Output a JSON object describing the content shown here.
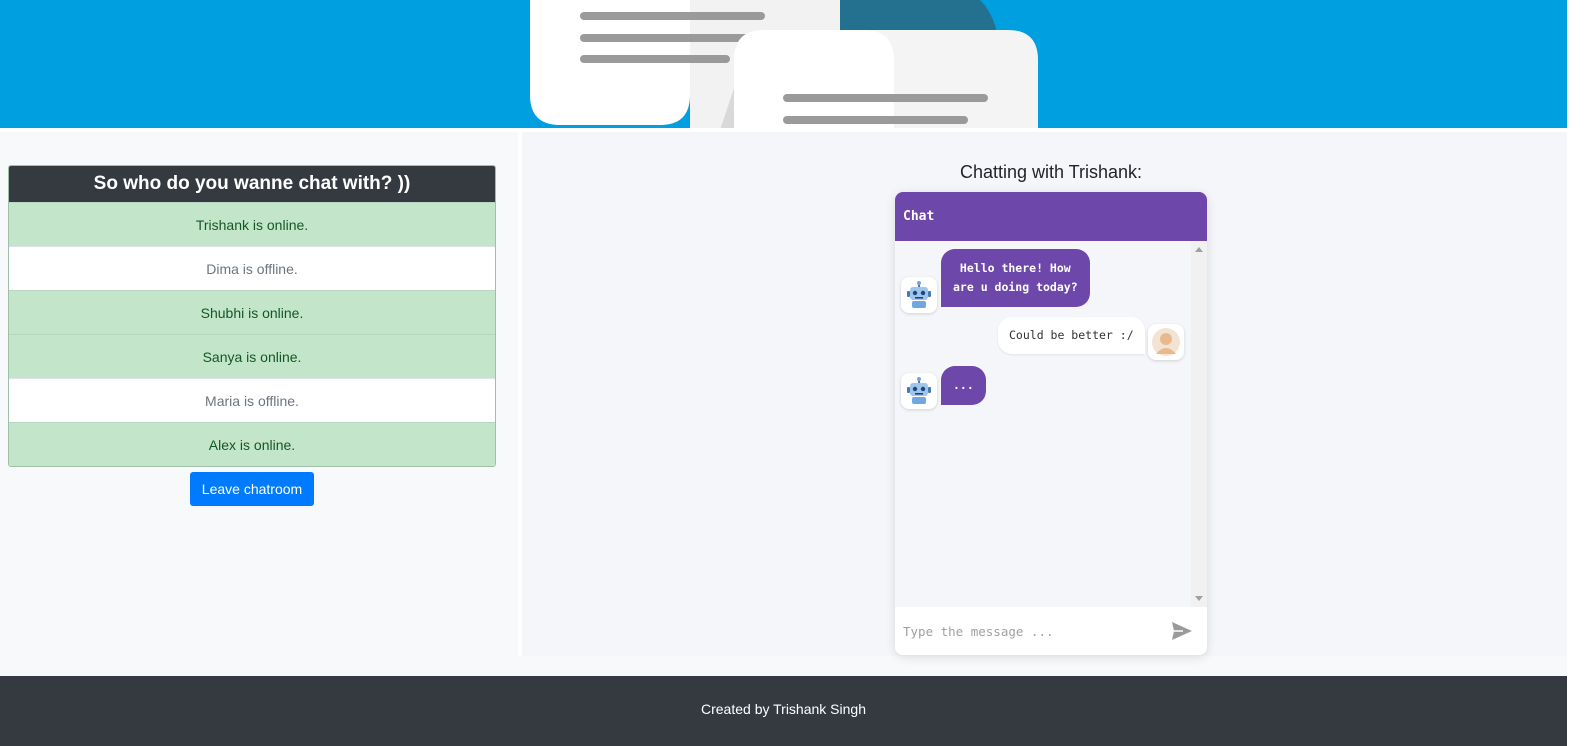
{
  "contacts": {
    "header": "So who do you wanne chat with? ))",
    "items": [
      {
        "text": "Trishank is online.",
        "status": "online"
      },
      {
        "text": "Dima is offline.",
        "status": "offline"
      },
      {
        "text": "Shubhi is online.",
        "status": "online"
      },
      {
        "text": "Sanya is online.",
        "status": "online"
      },
      {
        "text": "Maria is offline.",
        "status": "offline"
      },
      {
        "text": "Alex is online.",
        "status": "online"
      }
    ],
    "leave_label": "Leave chatroom"
  },
  "chat": {
    "title": "Chatting with Trishank:",
    "header": "Chat",
    "messages": [
      {
        "from": "bot",
        "line1": "Hello there! How",
        "line2": "are u doing today?"
      },
      {
        "from": "user",
        "text": "Could be better :/"
      },
      {
        "from": "bot",
        "text": "..."
      }
    ],
    "input_placeholder": "Type the message ..."
  },
  "footer": {
    "text": "Created by Trishank Singh"
  },
  "colors": {
    "banner": "#009fe0",
    "chat_accent": "#6d47aa",
    "online_bg": "#c3e6cb",
    "button": "#007bff",
    "dark": "#343a40"
  }
}
